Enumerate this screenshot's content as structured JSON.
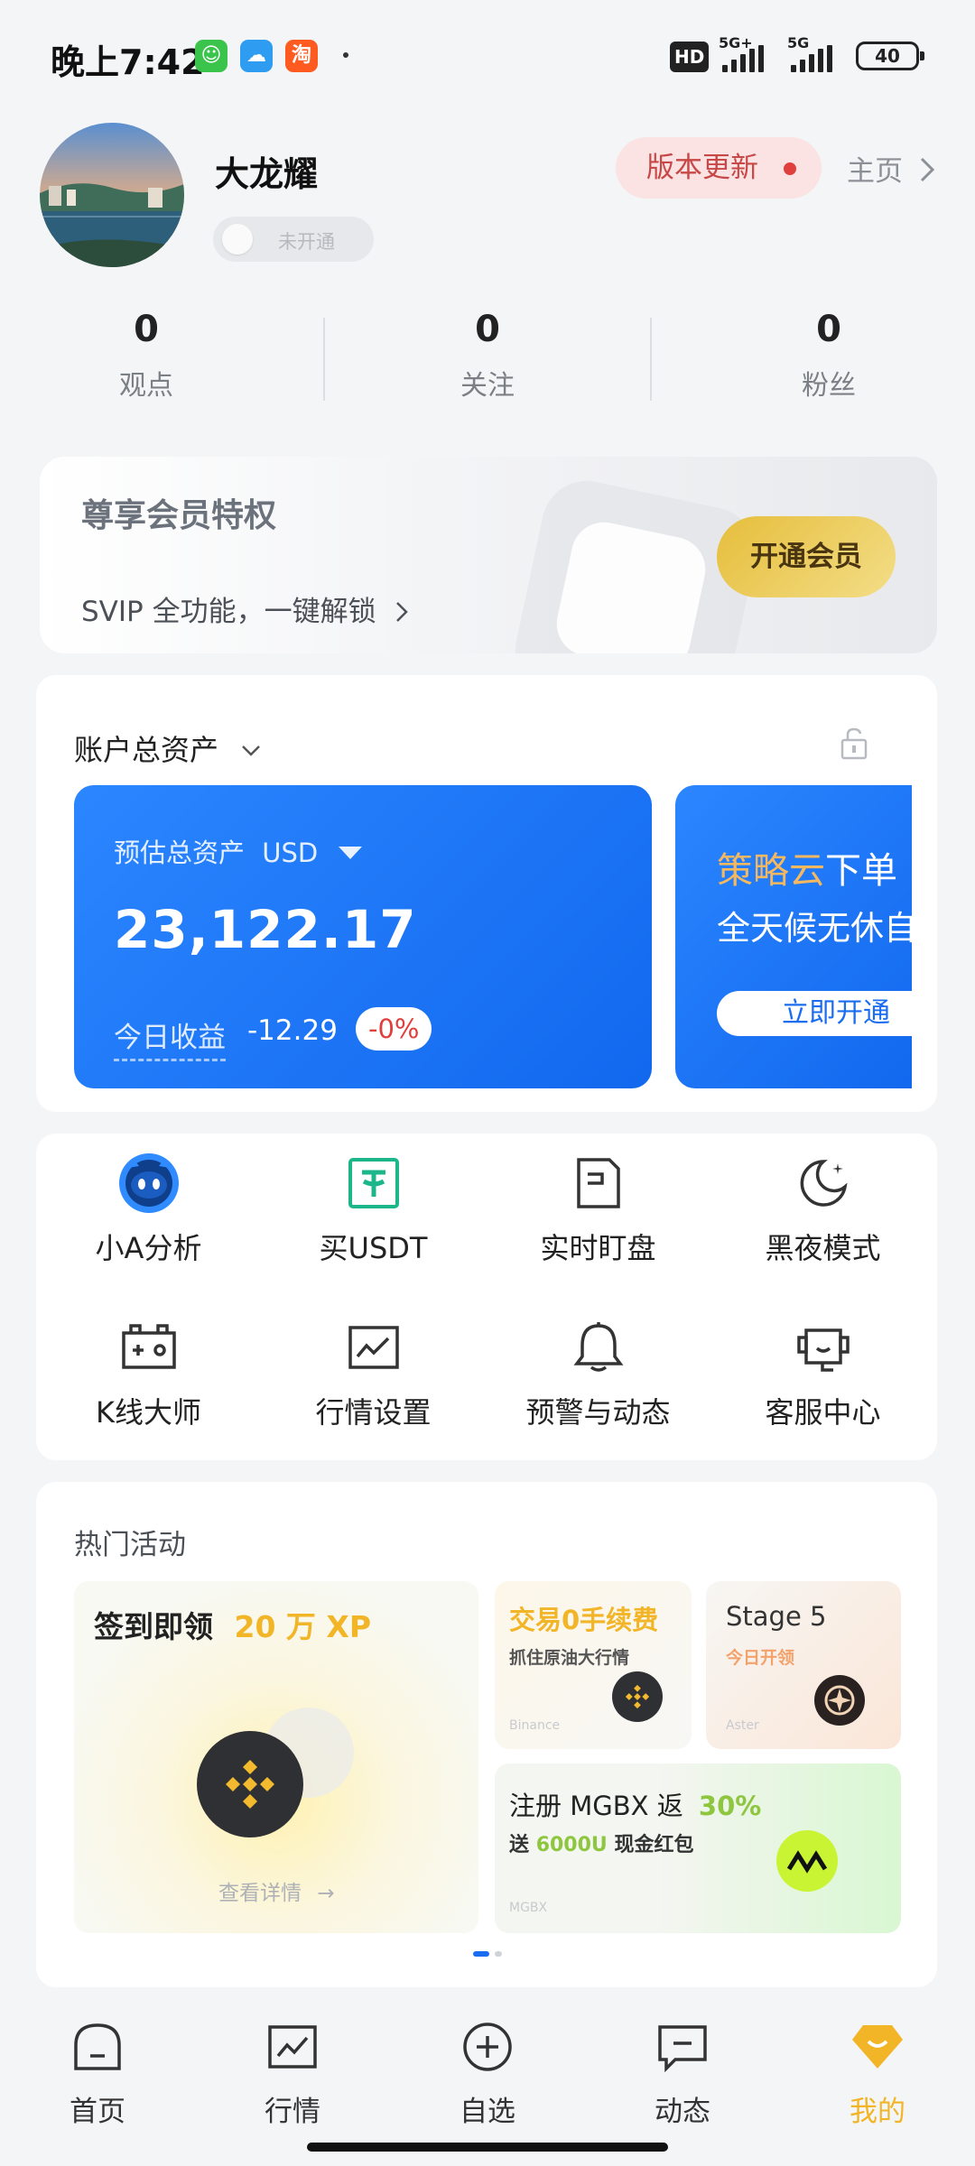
{
  "status_bar": {
    "time": "晚上7:42",
    "apps": [
      "chat-app",
      "weather-app",
      "淘"
    ],
    "network": [
      "HD",
      "5G+",
      "5G"
    ],
    "battery": "40"
  },
  "profile": {
    "name": "大龙耀",
    "vip_status": "未开通",
    "update_label": "版本更新",
    "home_label": "主页"
  },
  "stats": [
    {
      "value": "0",
      "label": "观点"
    },
    {
      "value": "0",
      "label": "关注"
    },
    {
      "value": "0",
      "label": "粉丝"
    }
  ],
  "member": {
    "title": "尊享会员特权",
    "subtitle": "SVIP 全功能，一键解锁",
    "button": "开通会员"
  },
  "assets": {
    "title": "账户总资产",
    "card_label": "预估总资产",
    "currency": "USD",
    "total": "23,122.17",
    "today_label": "今日收益",
    "today_change": "-12.29",
    "today_pct": "-0%"
  },
  "promo": {
    "title_highlight": "策略云",
    "title_rest": "下单",
    "subtitle": "全天候无休自",
    "button": "立即开通"
  },
  "tools": [
    {
      "label": "小A分析",
      "icon": "robot-icon"
    },
    {
      "label": "买USDT",
      "icon": "usdt-icon"
    },
    {
      "label": "实时盯盘",
      "icon": "watch-icon"
    },
    {
      "label": "黑夜模式",
      "icon": "moon-icon"
    },
    {
      "label": "K线大师",
      "icon": "kline-icon"
    },
    {
      "label": "行情设置",
      "icon": "chart-icon"
    },
    {
      "label": "预警与动态",
      "icon": "bell-icon"
    },
    {
      "label": "客服中心",
      "icon": "service-icon"
    }
  ],
  "activities": {
    "title": "热门活动",
    "big": {
      "title": "签到即领",
      "highlight": "20 万 XP",
      "detail": "查看详情"
    },
    "card1": {
      "title": "交易0手续费",
      "subtitle": "抓住原油大行情",
      "brand": "Binance"
    },
    "card2": {
      "title": "Stage 5",
      "subtitle": "今日开领",
      "brand": "Aster"
    },
    "card3": {
      "title": "注册 MGBX 返",
      "highlight": "30%",
      "sub_prefix": "送",
      "sub_highlight": "6000U",
      "sub_suffix": "现金红包",
      "brand": "MGBX"
    }
  },
  "nav": [
    {
      "label": "首页",
      "icon": "home-icon"
    },
    {
      "label": "行情",
      "icon": "market-icon"
    },
    {
      "label": "自选",
      "icon": "add-circle-icon"
    },
    {
      "label": "动态",
      "icon": "message-icon"
    },
    {
      "label": "我的",
      "icon": "profile-icon",
      "active": true
    }
  ],
  "colors": {
    "accent": "#1A6CF0",
    "gold": "#F1B527",
    "negative": "#E0403D"
  }
}
